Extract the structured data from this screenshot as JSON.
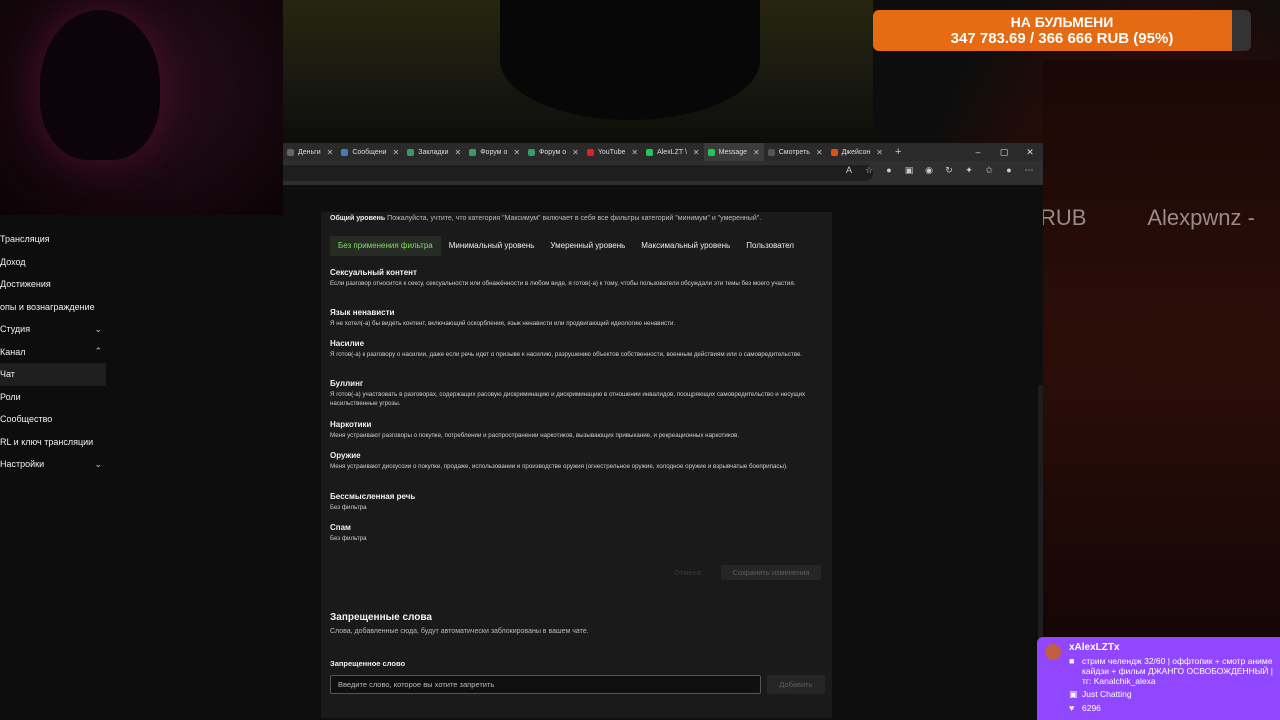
{
  "donation": {
    "title": "НА БУЛЬМЕНИ",
    "progress_text": "347 783.69 / 366 666 RUB (95%)",
    "progress_fraction": 0.95
  },
  "ticker": [
    "RUB",
    "Alexpwnz -"
  ],
  "sidebar": {
    "items": [
      {
        "label": "Трансляция",
        "chevron": ""
      },
      {
        "label": "Доход",
        "chevron": ""
      },
      {
        "label": "Достижения",
        "chevron": ""
      },
      {
        "label": "опы и вознаграждение",
        "chevron": ""
      },
      {
        "label": "Студия",
        "chevron": "chevron-down"
      },
      {
        "label": "Канал",
        "chevron": "chevron-up"
      },
      {
        "label": "Чат",
        "chevron": ""
      },
      {
        "label": "Роли",
        "chevron": ""
      },
      {
        "label": "Сообщество",
        "chevron": ""
      },
      {
        "label": "RL и ключ трансляции",
        "chevron": ""
      },
      {
        "label": "Настройки",
        "chevron": "chevron-down"
      }
    ]
  },
  "browser": {
    "tabs": [
      {
        "label": "Деньги",
        "color": "#666666"
      },
      {
        "label": "Сообщени",
        "color": "#4a7ab8"
      },
      {
        "label": "Закладки",
        "color": "#3a9a6a"
      },
      {
        "label": "Форум о",
        "color": "#3a9a6a"
      },
      {
        "label": "Форум о",
        "color": "#3a9a6a"
      },
      {
        "label": "YouTube",
        "color": "#e02020"
      },
      {
        "label": "AlexLZT \\",
        "color": "#22c55e"
      },
      {
        "label": "Message",
        "color": "#22c55e"
      },
      {
        "label": "Смотреть",
        "color": "#555555"
      },
      {
        "label": "Джейсон",
        "color": "#e05010"
      }
    ],
    "new_tab": "+",
    "window_controls": [
      "–",
      "▢",
      "✕"
    ]
  },
  "filter": {
    "top_label": "Общий уровень",
    "top_note": "Пожалуйста, учтите, что категория \"Максимум\" включает в себя все фильтры категорий \"минимум\" и \"умеренный\".",
    "tabs": [
      "Без применения фильтра",
      "Минимальный уровень",
      "Умеренный уровень",
      "Максимальный уровень",
      "Пользовател"
    ],
    "categories": [
      {
        "title": "Сексуальный контент",
        "text": "Если разговор относится к сексу, сексуальности или обнажённости в любом виде, я готов(-а) к тому, чтобы пользователи обсуждали эти темы без моего участия."
      },
      {
        "title": "Язык ненависти",
        "text": "Я не хотел(-а) бы видеть контент, включающий оскорбления, язык ненависти или продвигающий идеологию ненависти."
      },
      {
        "title": "Насилие",
        "text": "Я готов(-а) к разговору о насилии, даже если речь идет о призыве к насилию, разрушению объектов собственности, военным действиям или о самовредительстве."
      },
      {
        "title": "Буллинг",
        "text": "Я готов(-а) участвовать в разговорах, содержащих расовую дискриминацию и дискриминацию в отношении инвалидов, поощряющих самовредительство и несущих насильственные угрозы."
      },
      {
        "title": "Наркотики",
        "text": "Меня устраивают разговоры о покупке, потреблении и распространении наркотиков, вызывающих привыкание, и рекреационных наркотиков."
      },
      {
        "title": "Оружие",
        "text": "Меня устраивают дискуссии о покупке, продаже, использовании и производстве оружия (огнестрельное оружие, холодное оружие и взрывчатые боеприпасы)."
      },
      {
        "title": "Бессмысленная речь",
        "text": "Без фильтра"
      },
      {
        "title": "Спам",
        "text": "Без фильтра"
      }
    ],
    "cancel_label": "Отмена",
    "save_label": "Сохранить изменения"
  },
  "banned_words": {
    "title": "Запрещенные слова",
    "description": "Слова, добавленные сюда, будут автоматически заблокированы в вашем чате.",
    "field_label": "Запрещенное слово",
    "placeholder": "Введите слово, которое вы хотите запретить",
    "add_label": "Добавить"
  },
  "twitch": {
    "name": "xAlexLZTx",
    "title": "стрим челендж 32/60 | оффтопик + смотр аниме кайдзи + фильм ДЖАНГО ОСВОБОЖДЕННЫЙ | тг: Kanalchik_alexa",
    "category": "Just Chatting",
    "viewers": "6296"
  }
}
